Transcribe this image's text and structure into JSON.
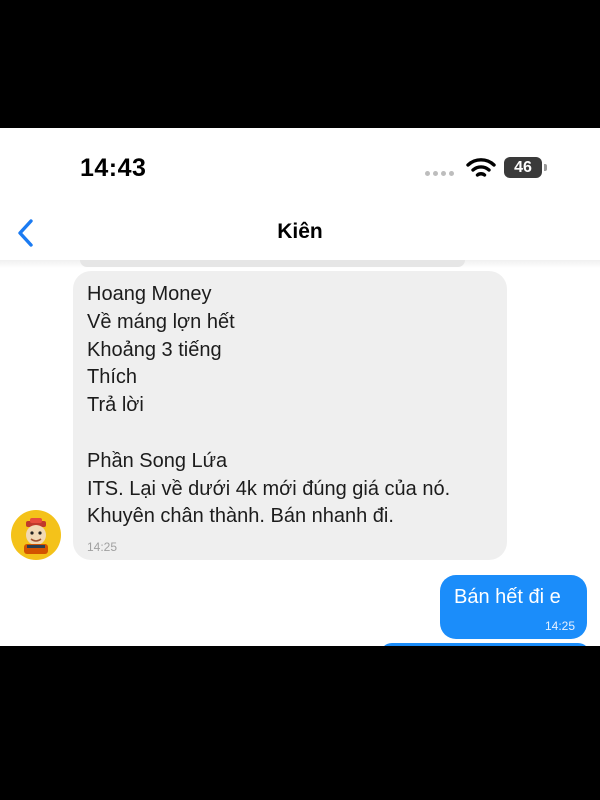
{
  "status_bar": {
    "time": "14:43",
    "battery": "46",
    "icons": [
      "signal-dots-icon",
      "wifi-icon",
      "battery-icon"
    ]
  },
  "nav": {
    "back_icon": "chevron-left-icon",
    "title": "Kiên"
  },
  "messages": {
    "incoming": {
      "text": "Hoang Money\nVề máng lợn hết\nKhoảng 3 tiếng\nThích\nTrả lời\n\nPhần Song Lứa\nITS. Lại về dưới 4k mới đúng giá của nó.\nKhuyên chân thành. Bán nhanh đi.",
      "time": "14:25"
    },
    "outgoing": {
      "text": "Bán hết đi e",
      "time": "14:25"
    }
  },
  "colors": {
    "accent": "#1b8dfa",
    "incoming_bubble": "#efefef",
    "background": "#ffffff",
    "letterbox": "#000000"
  }
}
